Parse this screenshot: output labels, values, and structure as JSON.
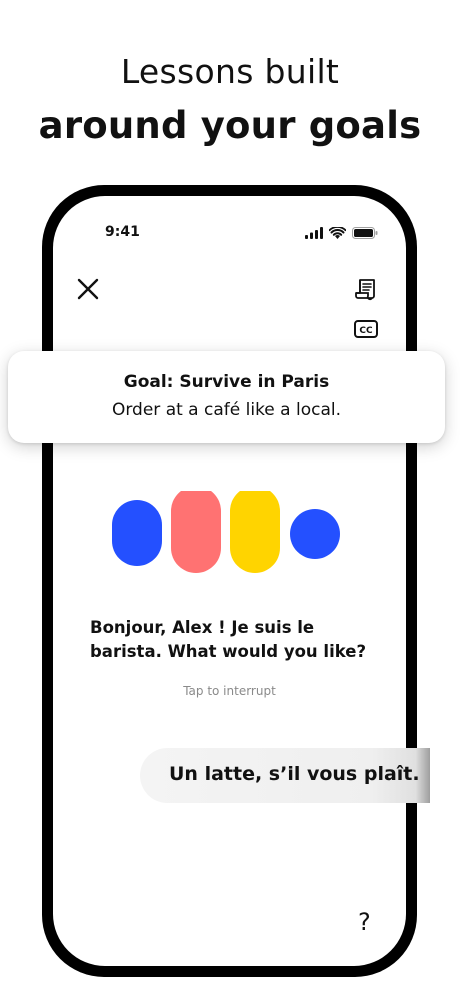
{
  "headline": {
    "line1": "Lessons built",
    "line2": "around your goals"
  },
  "status_bar": {
    "time": "9:41",
    "icons": [
      "cellular-signal-icon",
      "wifi-icon",
      "battery-icon"
    ]
  },
  "toolbar": {
    "close_icon": "close-icon",
    "transcript_icon": "transcript-icon",
    "captions_icon": "closed-captions-icon",
    "captions_label": "CC"
  },
  "goal_card": {
    "title": "Goal: Survive in Paris",
    "subtitle": "Order at a café like a local."
  },
  "voice_visualizer": {
    "colors": [
      "#2450FF",
      "#FF7272",
      "#FFD400",
      "#2450FF"
    ]
  },
  "conversation": {
    "agent_message": "Bonjour, Alex ! Je suis le barista. What would you like?",
    "hint": "Tap to interrupt",
    "user_message": "Un latte, s’il vous plaît."
  },
  "help": {
    "label": "?"
  }
}
